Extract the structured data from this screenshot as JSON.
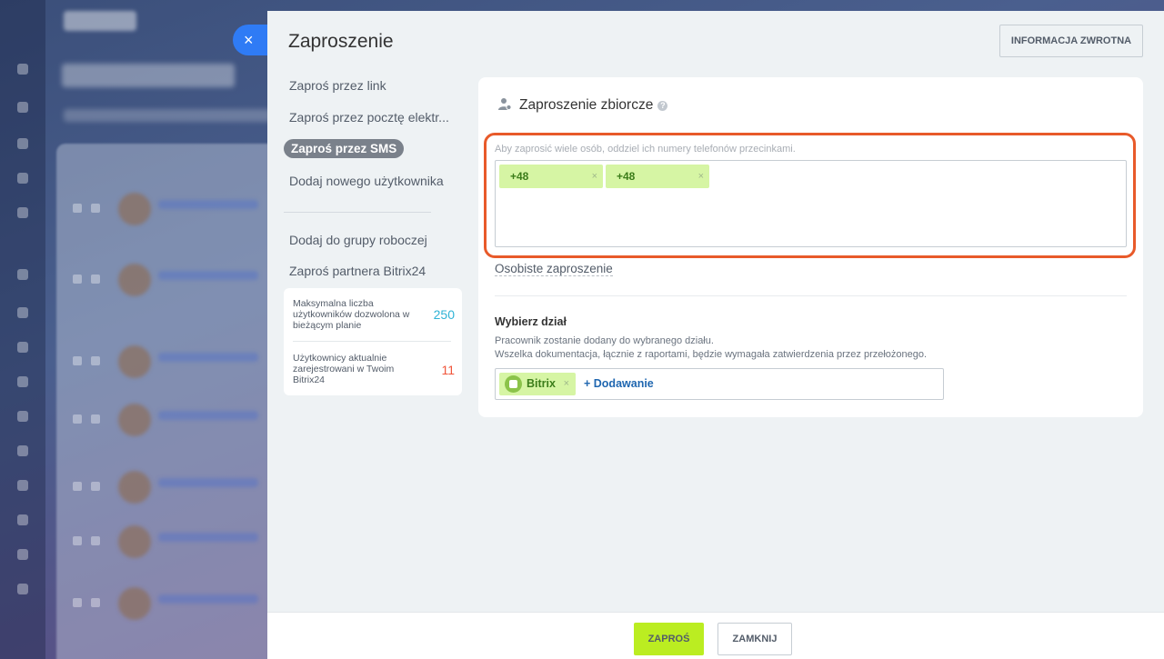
{
  "panel": {
    "title": "Zaproszenie",
    "feedback_label": "INFORMACJA ZWROTNA",
    "close_icon": "×"
  },
  "menu": {
    "items": [
      {
        "label": "Zaproś przez link"
      },
      {
        "label": "Zaproś przez pocztę elektr..."
      },
      {
        "label": "Zaproś przez SMS"
      },
      {
        "label": "Dodaj nowego użytkownika"
      },
      {
        "label": "Dodaj do grupy roboczej"
      },
      {
        "label": "Zaproś partnera Bitrix24"
      }
    ],
    "active_index": 2
  },
  "stats": {
    "max_users_label": "Maksymalna liczba użytkowników dozwolona w bieżącym planie",
    "max_users_value": "250",
    "registered_label": "Użytkownicy aktualnie zarejestrowani w Twoim Bitrix24",
    "registered_value": "11",
    "colors": {
      "max": "#2fb3d6",
      "registered": "#f0553a"
    }
  },
  "card": {
    "title": "Zaproszenie zbiorcze",
    "help_icon": "?",
    "hint": "Aby zaprosić wiele osób, oddziel ich numery telefonów przecinkami.",
    "phones": [
      {
        "value": "+48",
        "remove": "×"
      },
      {
        "value": "+48",
        "remove": "×"
      }
    ],
    "personal_link": "Osobiste zaproszenie",
    "department": {
      "title": "Wybierz dział",
      "desc_line1": "Pracownik zostanie dodany do wybranego działu.",
      "desc_line2": "Wszelka dokumentacja, łącznie z raportami, będzie wymagała zatwierdzenia przez przełożonego.",
      "selected": "Bitrix",
      "remove": "×",
      "add_label": "+ Dodawanie"
    }
  },
  "footer": {
    "invite_label": "ZAPROŚ",
    "close_label": "ZAMKNIJ"
  },
  "colors": {
    "accent_green": "#bbed21",
    "chip_green": "#d6f5a4",
    "highlight": "#e85a2a",
    "close_tab": "#2f7bf5"
  }
}
